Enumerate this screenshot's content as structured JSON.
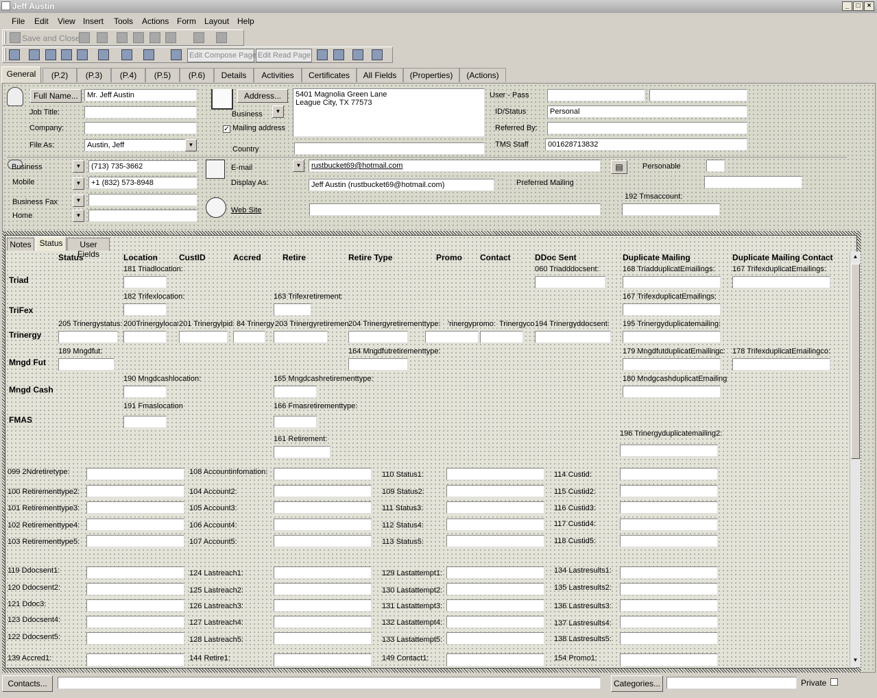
{
  "window": {
    "title": "Jeff Austin",
    "controls": [
      "_",
      "□",
      "×"
    ]
  },
  "menu": [
    "File",
    "Edit",
    "View",
    "Insert",
    "Tools",
    "Actions",
    "Form",
    "Layout",
    "Help"
  ],
  "toolbar": {
    "save_close": "Save and Close",
    "edit_compose": "Edit Compose Page",
    "edit_read": "Edit Read Page"
  },
  "tabs": [
    "General",
    "(P.2)",
    "(P.3)",
    "(P.4)",
    "(P.5)",
    "(P.6)",
    "Details",
    "Activities",
    "Certificates",
    "All Fields",
    "(Properties)",
    "(Actions)"
  ],
  "general": {
    "full_name_btn": "Full Name...",
    "full_name": "Mr. Jeff Austin",
    "job_title_lbl": "Job Title:",
    "job_title": "",
    "company_lbl": "Company:",
    "company": "",
    "file_as_lbl": "File As:",
    "file_as": "Austin, Jeff",
    "address_btn": "Address...",
    "address_type": "Business",
    "address": "5401 Magnolia Green Lane\nLeague City, TX  77573",
    "mailing_lbl": "Mailing address",
    "mailing_checked": true,
    "country_lbl": "Country",
    "country": "",
    "userpass_lbl": "User - Pass",
    "user": "",
    "pass": "",
    "idstatus_lbl": "ID/Status",
    "idstatus": "Personal",
    "referred_lbl": "Referred By:",
    "referred": "",
    "tms_lbl": "TMS Staff",
    "tms": "001628713832",
    "phones": [
      {
        "label": "Business",
        "value": "(713) 735-3662"
      },
      {
        "label": "Mobile",
        "value": "+1 (832) 573-8948"
      },
      {
        "label": "Business Fax",
        "value": ""
      },
      {
        "label": "Home",
        "value": ""
      }
    ],
    "email_lbl": "E-mail",
    "email": "rustbucket69@hotmail.com",
    "display_lbl": "Display As:",
    "display": "Jeff Austin (rustbucket69@hotmail.com)",
    "web_lbl": "Web Site",
    "web": "",
    "personable_lbl": "Personable",
    "preferred_lbl": "Preferred Mailing",
    "tmsacct_lbl": "192 Tmsaccount:"
  },
  "subtabs": [
    "Notes",
    "Status",
    "User Fields"
  ],
  "grid": {
    "columns": [
      "Status",
      "Location",
      "CustID",
      "Accred",
      "Retire",
      "Retire Type",
      "Promo",
      "Contact",
      "DDoc Sent",
      "Duplicate Mailing",
      "Duplicate Mailing Contact"
    ],
    "rows": [
      "Triad",
      "TriFex",
      "Trinergy",
      "Mngd Fut",
      "Mngd Cash",
      "FMAS"
    ],
    "labels": {
      "triad_loc": "181 Triadlocation:",
      "triad_ddoc": "060 Triadddocsent:",
      "triad_dup": "168 TriadduplicatEmailings:",
      "triad_dupc": "167 TrifexduplicatEmailings:",
      "trifex_loc": "182 Trifexlocation:",
      "trifex_ret": "163 Trifexretirement:",
      "trifex_dup": "167 TrifexduplicatEmailings:",
      "tri_status": "205 Trinergystatus:",
      "tri_loc": "200Trinergylocati",
      "tri_cust": "201 Trinergylpid:",
      "tri_accred": "84 Trinergy",
      "tri_ret": "203 Trinergyretiremen",
      "tri_rtype": "204 Trinergyretirementtype:",
      "tri_promo": "'rinergypromo:",
      "tri_contact": "Trinergyco",
      "tri_ddoc": "194 Trinergyddocsent:",
      "tri_dup": "195 Trinergyduplicatemailing:",
      "mf_status": "189 Mngdfut:",
      "mf_rtype": "164 Mngdfutretirementtype:",
      "mf_dup": "179 MngdfutduplicatEmailingc:",
      "mf_dupc": "178 TrifexduplicatEmailingco:",
      "mc_loc": "190 Mngdcashlocation:",
      "mc_ret": "165 Mngdcashretirementtype:",
      "mc_dup": "180 MndgcashduplicatEmailing:",
      "fm_loc": "191 Fmaslocation",
      "fm_ret": "166 Fmasretirementtype:",
      "ret161": "161 Retirement:",
      "tri_dup2": "196 Trinergyduplicatemailing2:"
    }
  },
  "fieldgrid": [
    [
      "099 2Ndretiretype:",
      "108 Accountinfomation:",
      "110 Status1:",
      "114 Custid:"
    ],
    [
      "100 Retirementtype2:",
      "104 Account2:",
      "109 Status2:",
      "115 Custid2:"
    ],
    [
      "101 Retirementtype3:",
      "105 Account3:",
      "111 Status3:",
      "116 Custid3:"
    ],
    [
      "102 Retirementtype4:",
      "106 Account4:",
      "112 Status4:",
      "117 Custid4:"
    ],
    [
      "103 Retirementtype5:",
      "107 Account5:",
      "113 Status5:",
      "118 Custid5:"
    ]
  ],
  "fieldgrid2": [
    [
      "119 Ddocsent1:",
      "124 Lastreach1:",
      "129 Lastattempt1:",
      "134 Lastresults1:"
    ],
    [
      "120 Ddocsent2:",
      "125 Lastreach2:",
      "130 Lastattempt2:",
      "135 Lastresults2:"
    ],
    [
      "121 Ddoc3:",
      "126 Lastreach3:",
      "131 Lastattempt3:",
      "136 Lastresults3:"
    ],
    [
      "123 Ddocsent4:",
      "127 Lastreach4:",
      "132 Lastattempt4:",
      "137 Lastresults4:"
    ],
    [
      "122 Ddocsent5:",
      "128 Lastreach5:",
      "133 Lastattempt5:",
      "138 Lastresults5:"
    ],
    [
      "139 Accred1:",
      "144 Retire1:",
      "149 Contact1:",
      "154 Promo1:"
    ]
  ],
  "bottom": {
    "contacts_btn": "Contacts...",
    "contacts": "",
    "categories_btn": "Categories...",
    "categories": "",
    "private_lbl": "Private"
  }
}
